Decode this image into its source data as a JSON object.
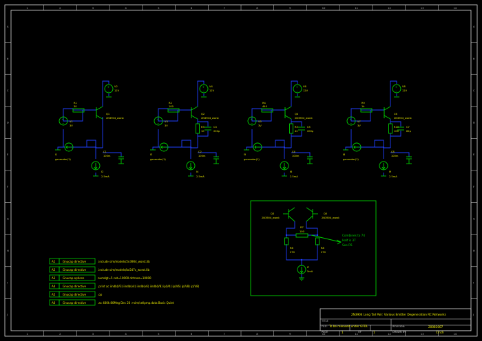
{
  "ruler": {
    "cols": [
      "1",
      "2",
      "3",
      "4",
      "5",
      "6",
      "7",
      "8",
      "9",
      "10",
      "11",
      "12",
      "13",
      "14"
    ],
    "rows": [
      "A",
      "B",
      "C",
      "D",
      "E",
      "F",
      "G",
      "H",
      "I",
      "J"
    ]
  },
  "stages": [
    {
      "supply": {
        "ref": "V2",
        "val": "12V"
      },
      "res": {
        "ref": "R1",
        "val": "30"
      },
      "vin": {
        "ref": "V1",
        "val": "3V"
      },
      "q": {
        "ref": "Q1",
        "model": "2N3904_worst"
      },
      "gen": {
        "ref": "I1",
        "val": "generator(1)"
      },
      "cap": {
        "ref": "C1",
        "val": "100m"
      },
      "isrc": {
        "ref": "I2",
        "val": "2.5mA"
      },
      "re": null,
      "cp": null
    },
    {
      "supply": {
        "ref": "V4",
        "val": "12V"
      },
      "res": {
        "ref": "R2",
        "val": "100"
      },
      "vin": {
        "ref": "V3",
        "val": "3V"
      },
      "q": {
        "ref": "Q2",
        "model": "2N3904_worst"
      },
      "gen": {
        "ref": "I3",
        "val": "generator(1)"
      },
      "cap": {
        "ref": "C2",
        "val": "100m"
      },
      "isrc": {
        "ref": "I4",
        "val": "2.5mA"
      },
      "re": {
        "ref": "R3",
        "val": "10"
      },
      "cp": {
        "ref": "C3",
        "val": "200p"
      }
    },
    {
      "supply": {
        "ref": "V6",
        "val": "12V"
      },
      "res": {
        "ref": "R4",
        "val": "440"
      },
      "vin": {
        "ref": "V5",
        "val": "3V"
      },
      "q": {
        "ref": "Q4",
        "model": "2N3904_worst"
      },
      "gen": {
        "ref": "I5",
        "val": "generator(1)"
      },
      "cap": {
        "ref": "C4",
        "val": "100m"
      },
      "isrc": {
        "ref": "I6",
        "val": "2.5mA"
      },
      "re": {
        "ref": "R5",
        "val": "42"
      },
      "cp": {
        "ref": "C5",
        "val": "200p"
      }
    },
    {
      "supply": {
        "ref": "V8",
        "val": "12V"
      },
      "res": {
        "ref": "R9",
        "val": "1k"
      },
      "vin": {
        "ref": "V7",
        "val": "3V"
      },
      "q": {
        "ref": "C6",
        "model": "2N3904_worst"
      },
      "gen": {
        "ref": "I8",
        "val": "generator(1)"
      },
      "cap": {
        "ref": "C8",
        "val": "100m"
      },
      "isrc": {
        "ref": "I9",
        "val": "2.5mA"
      },
      "re": {
        "ref": "R10",
        "val": "100"
      },
      "cp": {
        "ref": "C7",
        "val": "82p"
      }
    }
  ],
  "pair": {
    "q_left": {
      "ref": "Q3",
      "model": "2N3904_worst"
    },
    "q_right": {
      "ref": "Q5",
      "model": "2N3904_worst"
    },
    "r_top": {
      "ref": "R7",
      "val": "100"
    },
    "r_left": {
      "ref": "R6",
      "val": "270"
    },
    "r_right": {
      "ref": "R8",
      "val": "270"
    },
    "isrc": {
      "ref": "I7",
      "val": "5mA"
    },
    "note": [
      "Combines to 74",
      "Half is 37",
      "See R5"
    ]
  },
  "directives": [
    {
      "id": "A1",
      "btn": "Gnucap directive",
      "text": ".include sim/models/2n3904_worst.lib"
    },
    {
      "id": "A2",
      "btn": "Gnucap directive",
      "text": ".include sim/models/bc547c_worst.lib"
    },
    {
      "id": "A3",
      "btn": "Gnucap options",
      "text": "numdgt=5 cut=10000 dctrace=10000"
    },
    {
      "id": "A4",
      "btn": "Gnucap directive",
      "text": ".print ac iindb(V3) iindb(v4) iindb(v6) iindb(V8) ip(V4) ip(V6) ip(V8) ip(V8)"
    },
    {
      "id": "A5",
      "btn": "Gnucap directive",
      "text": ".op"
    },
    {
      "id": "A6",
      "btn": "Gnucap directive",
      "text": ".ac 400k 80Meg Dec 20 >sim/cellpmp.data Basic Quiet"
    }
  ],
  "title_block": {
    "title": "2N3904 Long Tail Pair: Various Emitter Degeneration RC Networks",
    "title_label": "TITLE",
    "file_label": "FILE:",
    "file_value": "To be released under GFDL",
    "revision_label": "REVISION:",
    "revision_value": "20081007",
    "page_label": "PAGE",
    "page_value": "1",
    "of_label": "OF",
    "of_value": "1",
    "drawn_label": "DRAWN BY:",
    "drawn_value": "Cinch"
  },
  "colors": {
    "wire": "#2040ff",
    "component": "#00d000",
    "label": "#e8e800",
    "frame": "#dddddd"
  }
}
